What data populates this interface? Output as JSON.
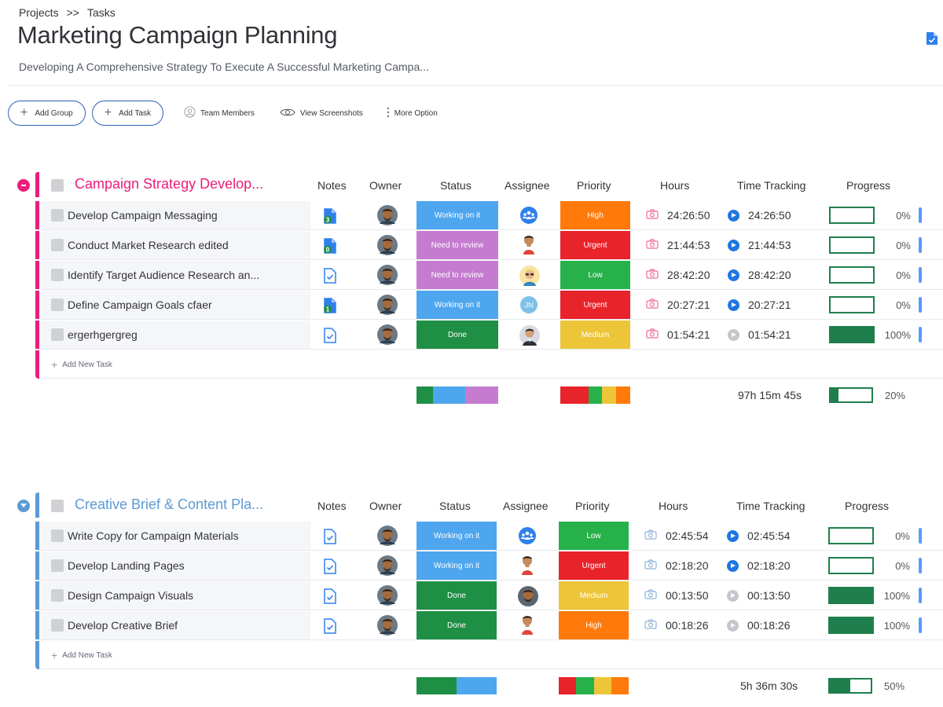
{
  "breadcrumb": {
    "first": "Projects",
    "sep": ">>",
    "second": "Tasks"
  },
  "page": {
    "title": "Marketing Campaign Planning",
    "subtitle": "Developing A Comprehensive Strategy To Execute A Successful Marketing Campa..."
  },
  "toolbar": {
    "add_group": "Add Group",
    "add_task": "Add Task",
    "team_members": "Team Members",
    "view_screenshots": "View Screenshots",
    "more_option": "More Option"
  },
  "columns": {
    "notes": "Notes",
    "owner": "Owner",
    "status": "Status",
    "assignee": "Assignee",
    "priority": "Priority",
    "hours": "Hours",
    "time_tracking": "Time Tracking",
    "progress": "Progress"
  },
  "colors": {
    "working_on_it": "#4ea6ee",
    "need_to_review": "#c57cd0",
    "done": "#1f8f45",
    "high": "#ff7a0b",
    "urgent": "#e8232a",
    "low": "#27b14b",
    "medium": "#ecc538",
    "group1": "#e91e7a",
    "group2": "#5b9bd5"
  },
  "groups": [
    {
      "title": "Campaign Strategy Develop...",
      "color": "#e91e7a",
      "add_task_label": "Add New Task",
      "tasks": [
        {
          "name": "Develop Campaign Messaging",
          "note_count": "3",
          "status": "Working on it",
          "assignee": "team-icon",
          "priority": "High",
          "hours": "24:26:50",
          "time_tracking": "24:26:50",
          "tracking_active": true,
          "progress": 0,
          "progress_label": "0%"
        },
        {
          "name": "Conduct Market Research edited",
          "note_count": "0",
          "status": "Need to review",
          "assignee": "person-red",
          "priority": "Urgent",
          "hours": "21:44:53",
          "time_tracking": "21:44:53",
          "tracking_active": true,
          "progress": 0,
          "progress_label": "0%"
        },
        {
          "name": "Identify Target Audience Research an...",
          "note_count": "",
          "status": "Need to review",
          "assignee": "person-glasses",
          "priority": "Low",
          "hours": "28:42:20",
          "time_tracking": "28:42:20",
          "tracking_active": true,
          "progress": 0,
          "progress_label": "0%"
        },
        {
          "name": "Define Campaign Goals cfaer",
          "note_count": "1",
          "status": "Working on it",
          "assignee": "JN",
          "priority": "Urgent",
          "hours": "20:27:21",
          "time_tracking": "20:27:21",
          "tracking_active": true,
          "progress": 0,
          "progress_label": "0%"
        },
        {
          "name": "ergerhgergreg",
          "note_count": "",
          "status": "Done",
          "assignee": "person-suit",
          "priority": "Medium",
          "hours": "01:54:21",
          "time_tracking": "01:54:21",
          "tracking_active": false,
          "progress": 100,
          "progress_label": "100%"
        }
      ],
      "summary": {
        "status_dist": [
          {
            "color": "#1f8f45",
            "pct": 20
          },
          {
            "color": "#4ea6ee",
            "pct": 40
          },
          {
            "color": "#c57cd0",
            "pct": 40
          }
        ],
        "priority_dist": [
          {
            "color": "#e8232a",
            "pct": 40
          },
          {
            "color": "#27b14b",
            "pct": 20
          },
          {
            "color": "#ecc538",
            "pct": 20
          },
          {
            "color": "#ff7a0b",
            "pct": 20
          }
        ],
        "total_time": "97h 15m 45s",
        "progress": 20,
        "progress_label": "20%"
      }
    },
    {
      "title": "Creative Brief & Content Pla...",
      "color": "#5b9bd5",
      "add_task_label": "Add New Task",
      "tasks": [
        {
          "name": "Write Copy for Campaign Materials",
          "note_count": "",
          "status": "Working on it",
          "assignee": "team-icon",
          "priority": "Low",
          "hours": "02:45:54",
          "time_tracking": "02:45:54",
          "tracking_active": true,
          "progress": 0,
          "progress_label": "0%"
        },
        {
          "name": "Develop Landing Pages",
          "note_count": "",
          "status": "Working on it",
          "assignee": "person-red",
          "priority": "Urgent",
          "hours": "02:18:20",
          "time_tracking": "02:18:20",
          "tracking_active": true,
          "progress": 0,
          "progress_label": "0%"
        },
        {
          "name": "Design Campaign Visuals",
          "note_count": "",
          "status": "Done",
          "assignee": "person-photo",
          "priority": "Medium",
          "hours": "00:13:50",
          "time_tracking": "00:13:50",
          "tracking_active": false,
          "progress": 100,
          "progress_label": "100%"
        },
        {
          "name": "Develop Creative Brief",
          "note_count": "",
          "status": "Done",
          "assignee": "person-red",
          "priority": "High",
          "hours": "00:18:26",
          "time_tracking": "00:18:26",
          "tracking_active": false,
          "progress": 100,
          "progress_label": "100%"
        }
      ],
      "summary": {
        "status_dist": [
          {
            "color": "#1f8f45",
            "pct": 50
          },
          {
            "color": "#4ea6ee",
            "pct": 50
          }
        ],
        "priority_dist": [
          {
            "color": "#e8232a",
            "pct": 25
          },
          {
            "color": "#27b14b",
            "pct": 25
          },
          {
            "color": "#ecc538",
            "pct": 25
          },
          {
            "color": "#ff7a0b",
            "pct": 25
          }
        ],
        "total_time": "5h 36m 30s",
        "progress": 50,
        "progress_label": "50%"
      }
    }
  ]
}
